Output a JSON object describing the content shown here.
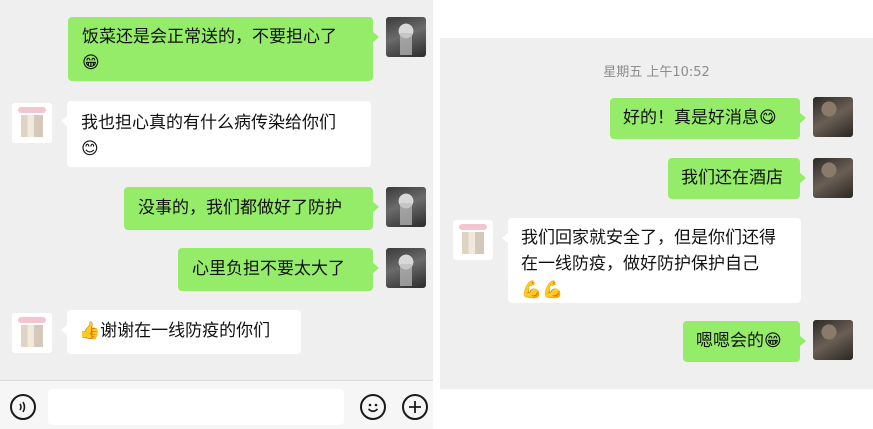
{
  "left_chat": {
    "messages": [
      {
        "text": "饭菜还是会正常送的，不要担心了",
        "emoji": "😁"
      },
      {
        "text": "我也担心真的有什么病传染给你们",
        "emoji": "😊"
      },
      {
        "text": "没事的，我们都做好了防护"
      },
      {
        "text": "心里负担不要太大了"
      },
      {
        "emoji": "👍",
        "text": "谢谢在一线防疫的你们"
      }
    ],
    "input_bar": {
      "voice_icon": "voice-icon",
      "emoji_icon": "smiley-icon",
      "plus_icon": "plus-icon"
    }
  },
  "right_chat": {
    "timestamp": "星期五 上午10:52",
    "messages": [
      {
        "text": "好的！真是好消息",
        "emoji": "😋"
      },
      {
        "text": "我们还在酒店"
      },
      {
        "line1": "我们回家就安全了，但是你们还得",
        "line2": "在一线防疫，做好防护保护自己",
        "emoji": "💪💪"
      },
      {
        "text": "嗯嗯会的",
        "emoji": "😁"
      }
    ]
  },
  "colors": {
    "outgoing_bubble": "#95ec69",
    "incoming_bubble": "#ffffff",
    "background": "#efefef"
  }
}
